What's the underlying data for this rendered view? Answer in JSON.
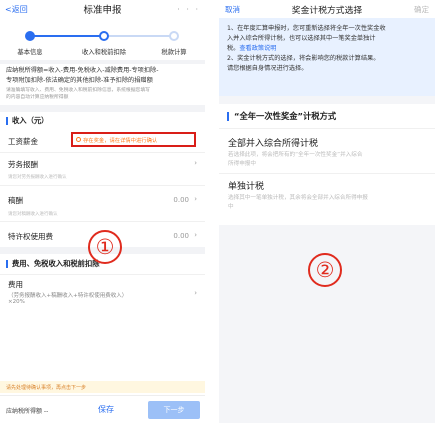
{
  "left": {
    "nav": {
      "back": "<返回",
      "title": "标准申报",
      "more": "· · ·"
    },
    "steps": [
      {
        "label": "基本信息",
        "state": "done"
      },
      {
        "label": "收入和税前扣除",
        "state": "active"
      },
      {
        "label": "税款计算",
        "state": "todo"
      }
    ],
    "formula": {
      "line1": "应纳税所得额=收入-费用-免税收入-减除费用-专项扣除-",
      "line2": "专项附加扣除-依法确定的其他扣除-准予扣除的捐赠额"
    },
    "note": {
      "line1": "请准确填写收入、费用、免税收入和税前扣除信息，系统根据您填写",
      "line2": "的内容自动计算应纳税所得额"
    },
    "income_section": "收入（元）",
    "rows": {
      "salary": {
        "label": "工资薪金",
        "alert": "存在奖金，请在详情中进行确认"
      },
      "labor": {
        "label": "劳务报酬",
        "hint": "请您对劳务报酬收入进行确认"
      },
      "royalty": {
        "label": "稿酬",
        "value": "0.00",
        "hint": "请您对稿酬收入进行确认"
      },
      "franchise": {
        "label": "特许权使用费",
        "value": "0.00"
      }
    },
    "deduction_section": "费用、免税收入和税前扣除",
    "fee": {
      "label": "费用",
      "desc1": "（劳务报酬收入+稿酬收入+特许权使用费收入）",
      "desc2": "×20%"
    },
    "warning": "请先处理待确认事项，再点击下一步",
    "bottom": {
      "total": "应纳税所得额 --",
      "save": "保存",
      "next": "下一步"
    },
    "marker": "①"
  },
  "right": {
    "nav": {
      "cancel": "取消",
      "title": "奖金计税方式选择",
      "confirm": "确定"
    },
    "tip": {
      "line1": "1、在年度汇算申报时，您可重新选择将全年一次性奖金收",
      "line2": "入并入综合所得计税，也可以选择其中一笔奖金单独计",
      "line3": "税。",
      "link": "查看政策说明",
      "line4": "2、奖金计税方式的选择，将会影响您的税款计算结果。",
      "line5": "请您根据自身情况进行选择。"
    },
    "method_heading": "“全年一次性奖金”计税方式",
    "options": [
      {
        "title": "全部并入综合所得计税",
        "desc1": "若选择此项，将会把所有的“全年一次性奖金”并入综合",
        "desc2": "所得申报中"
      },
      {
        "title": "单独计税",
        "desc1": "选择其中一笔单独计税，其余将会全部并入综合所得申报",
        "desc2": "中"
      }
    ],
    "marker": "②"
  },
  "colors": {
    "accent": "#2a6ef0",
    "alert_border": "#d91e18",
    "alert_text": "#ff7a1a",
    "marker": "#e02b1e"
  }
}
